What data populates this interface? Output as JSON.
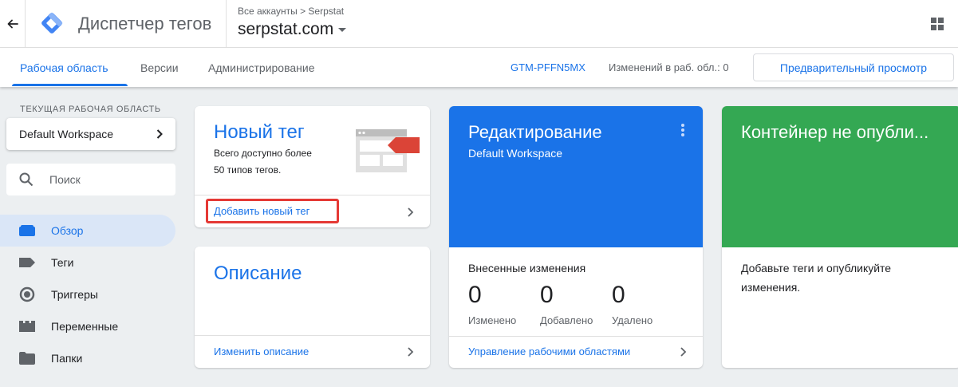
{
  "header": {
    "app_title": "Диспетчер тегов",
    "breadcrumb": "Все аккаунты > Serpstat",
    "container_name": "serpstat.com"
  },
  "tabs": {
    "workspace": "Рабочая область",
    "versions": "Версии",
    "admin": "Администрирование",
    "gtm_id": "GTM-PFFN5MX",
    "changes_count": "Изменений в раб. обл.: 0",
    "preview_label": "Предварительный просмотр"
  },
  "sidebar": {
    "workspace_label": "ТЕКУЩАЯ РАБОЧАЯ ОБЛАСТЬ",
    "workspace_name": "Default Workspace",
    "search_placeholder": "Поиск",
    "items": [
      {
        "label": "Обзор",
        "icon": "overview-icon"
      },
      {
        "label": "Теги",
        "icon": "tag-icon"
      },
      {
        "label": "Триггеры",
        "icon": "trigger-icon"
      },
      {
        "label": "Переменные",
        "icon": "variable-icon"
      },
      {
        "label": "Папки",
        "icon": "folder-icon"
      }
    ]
  },
  "new_tag_card": {
    "title": "Новый тег",
    "line1": "Всего доступно более",
    "line2": "50 типов тегов.",
    "link": "Добавить новый тег"
  },
  "description_card": {
    "title": "Описание",
    "link": "Изменить описание"
  },
  "editing_card": {
    "title": "Редактирование",
    "subtitle": "Default Workspace",
    "changes_heading": "Внесенные изменения",
    "modified_value": "0",
    "modified_label": "Изменено",
    "added_value": "0",
    "added_label": "Добавлено",
    "deleted_value": "0",
    "deleted_label": "Удалено",
    "link": "Управление рабочими областями"
  },
  "publish_card": {
    "title": "Контейнер не опубли...",
    "line1": "Добавьте теги и опубликуйте",
    "line2": "изменения."
  },
  "colors": {
    "accent": "#1a73e8",
    "editing_bg": "#1a73e8",
    "publish_bg": "#34a853",
    "highlight": "#e53935"
  }
}
